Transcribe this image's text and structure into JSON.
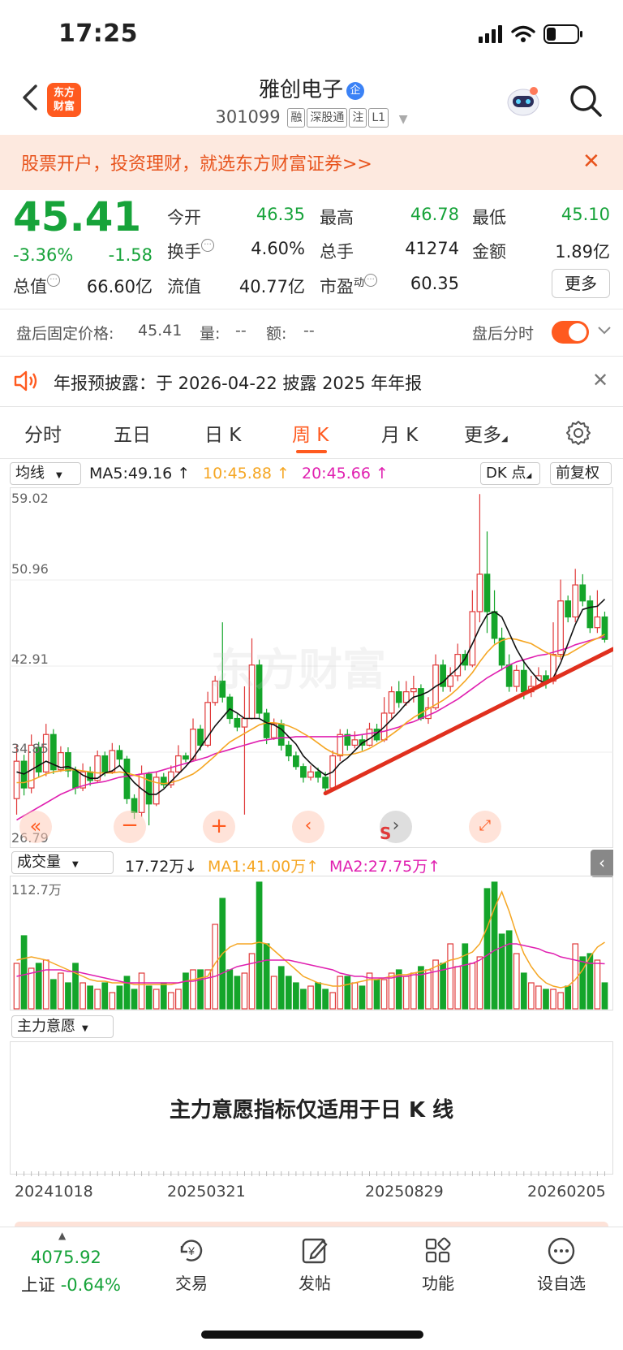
{
  "status": {
    "time": "17:25"
  },
  "header": {
    "logo_line1": "东方",
    "logo_line2": "财富",
    "stock_name": "雅创电子",
    "name_badge": "企",
    "code": "301099",
    "tags": [
      "融",
      "深股通",
      "注",
      "L1"
    ]
  },
  "promo": {
    "text": "股票开户，投资理财，就选东方财富证券>>",
    "close": "✕"
  },
  "quote": {
    "price": "45.41",
    "change_pct": "-3.36%",
    "change_abs": "-1.58",
    "open_label": "今开",
    "open": "46.35",
    "high_label": "最高",
    "high": "46.78",
    "low_label": "最低",
    "low": "45.10",
    "turnover_label": "换手",
    "turnover": "4.60%",
    "volume_label": "总手",
    "volume": "41274",
    "amount_label": "金额",
    "amount": "1.89亿",
    "mktcap_label": "总值",
    "mktcap": "66.60亿",
    "float_label": "流值",
    "float": "40.77亿",
    "pe_label": "市盈",
    "pe_sup": "动",
    "pe": "60.35",
    "more": "更多"
  },
  "after_hours": {
    "label": "盘后固定价格:",
    "price": "45.41",
    "vol_label": "量:",
    "vol": "--",
    "amt_label": "额:",
    "amt": "--",
    "toggle_label": "盘后分时",
    "toggle_on": true
  },
  "notice": {
    "text": "年报预披露：于 2026-04-22 披露 2025 年年报",
    "close": "✕"
  },
  "tabs": [
    {
      "label": "分时"
    },
    {
      "label": "五日"
    },
    {
      "label": "日 K"
    },
    {
      "label": "周 K",
      "active": true
    },
    {
      "label": "月 K"
    },
    {
      "label": "更多"
    }
  ],
  "kline": {
    "indicator": "均线",
    "ma5": "MA5:49.16",
    "ma10": "10:45.88",
    "ma20": "20:45.66",
    "dk": "DK 点",
    "adjust": "前复权",
    "y_ticks": [
      "59.02",
      "50.96",
      "42.91",
      "34.85",
      "26.79"
    ],
    "watermark": "东方财富",
    "colors": {
      "up": "#e03a3a",
      "down": "#14a52a",
      "ma5": "#111111",
      "ma10": "#f5a623",
      "ma20": "#e020b0",
      "trend": "#e0301e"
    }
  },
  "volume": {
    "indicator": "成交量",
    "value": "17.72万",
    "ma1": "MA1:41.00万",
    "ma2": "MA2:27.75万",
    "y_max": "112.7万"
  },
  "zl": {
    "indicator": "主力意愿",
    "message": "主力意愿指标仅适用于日 K 线"
  },
  "dates": [
    "20241018",
    "20250321",
    "20250829",
    "20260205"
  ],
  "bottom": {
    "index_value": "4075.92",
    "index_name": "上证",
    "index_change": "-0.64%",
    "nav": [
      {
        "label": "交易",
        "icon": "yen-cycle-icon"
      },
      {
        "label": "发帖",
        "icon": "edit-icon"
      },
      {
        "label": "功能",
        "icon": "grid-icon"
      },
      {
        "label": "设自选",
        "icon": "more-dots-icon"
      }
    ]
  },
  "chart_data": {
    "type": "candlestick",
    "title": "",
    "y_range": [
      26.79,
      59.02
    ],
    "candles": [
      [
        30.5,
        34.0,
        29.0,
        35.5
      ],
      [
        34.0,
        31.5,
        30.8,
        34.6
      ],
      [
        31.5,
        35.5,
        31.0,
        36.5
      ],
      [
        35.3,
        33.0,
        32.5,
        35.8
      ],
      [
        33.0,
        36.5,
        32.6,
        37.5
      ],
      [
        36.5,
        33.2,
        32.8,
        37.0
      ],
      [
        33.2,
        34.8,
        33.0,
        35.4
      ],
      [
        34.8,
        33.1,
        32.5,
        35.3
      ],
      [
        33.1,
        31.5,
        30.9,
        33.5
      ],
      [
        31.5,
        33.0,
        31.2,
        33.8
      ],
      [
        33.0,
        32.2,
        31.7,
        33.5
      ],
      [
        32.2,
        34.5,
        32.0,
        35.0
      ],
      [
        34.5,
        33.0,
        32.6,
        34.9
      ],
      [
        33.0,
        35.0,
        32.8,
        35.7
      ],
      [
        35.0,
        34.2,
        33.6,
        35.5
      ],
      [
        34.2,
        30.5,
        30.0,
        34.5
      ],
      [
        30.5,
        29.2,
        28.6,
        30.9
      ],
      [
        29.2,
        32.8,
        28.8,
        33.6
      ],
      [
        32.8,
        30.0,
        28.0,
        33.0
      ],
      [
        30.0,
        32.5,
        29.8,
        33.0
      ],
      [
        32.5,
        31.8,
        31.5,
        32.9
      ],
      [
        31.8,
        33.0,
        31.5,
        33.6
      ],
      [
        33.0,
        34.5,
        32.9,
        35.5
      ],
      [
        34.5,
        34.2,
        33.9,
        34.8
      ],
      [
        34.2,
        37.0,
        34.0,
        38.0
      ],
      [
        37.0,
        35.5,
        35.0,
        37.4
      ],
      [
        35.5,
        39.5,
        35.3,
        40.5
      ],
      [
        39.5,
        41.5,
        39.2,
        42.0
      ],
      [
        41.5,
        40.0,
        39.5,
        47.0
      ],
      [
        40.0,
        38.0,
        37.5,
        40.3
      ],
      [
        38.0,
        37.2,
        36.8,
        38.4
      ],
      [
        37.2,
        38.0,
        29.0,
        41.0
      ],
      [
        38.0,
        43.0,
        37.9,
        45.5
      ],
      [
        43.0,
        38.5,
        38.0,
        43.5
      ],
      [
        38.5,
        36.2,
        35.6,
        38.9
      ],
      [
        36.2,
        37.5,
        36.0,
        38.0
      ],
      [
        37.5,
        35.5,
        35.0,
        37.9
      ],
      [
        35.5,
        34.5,
        34.0,
        35.9
      ],
      [
        34.5,
        33.5,
        33.2,
        34.9
      ],
      [
        33.5,
        32.5,
        32.0,
        33.8
      ],
      [
        32.5,
        33.0,
        32.2,
        33.6
      ],
      [
        33.0,
        32.5,
        32.0,
        33.4
      ],
      [
        32.5,
        31.5,
        31.0,
        33.0
      ],
      [
        31.5,
        34.5,
        31.2,
        35.0
      ],
      [
        34.5,
        36.5,
        34.0,
        37.0
      ],
      [
        36.5,
        35.5,
        35.0,
        37.0
      ],
      [
        35.5,
        36.0,
        35.2,
        36.8
      ],
      [
        36.0,
        35.5,
        35.0,
        36.5
      ],
      [
        35.5,
        37.0,
        35.4,
        37.6
      ],
      [
        37.0,
        36.0,
        35.8,
        37.5
      ],
      [
        36.0,
        38.5,
        35.8,
        40.0
      ],
      [
        38.5,
        40.5,
        38.0,
        41.0
      ],
      [
        40.5,
        39.5,
        39.0,
        41.5
      ],
      [
        39.5,
        40.5,
        39.2,
        41.5
      ],
      [
        40.5,
        40.8,
        39.5,
        42.0
      ],
      [
        40.8,
        38.0,
        37.8,
        41.2
      ],
      [
        38.0,
        39.0,
        37.5,
        40.0
      ],
      [
        39.0,
        43.0,
        38.8,
        44.0
      ],
      [
        43.0,
        41.0,
        40.5,
        43.5
      ],
      [
        41.0,
        42.0,
        40.5,
        42.8
      ],
      [
        42.0,
        44.0,
        41.5,
        45.0
      ],
      [
        44.0,
        43.0,
        42.5,
        44.4
      ],
      [
        43.0,
        48.0,
        42.8,
        50.0
      ],
      [
        48.0,
        51.5,
        47.0,
        59.0
      ],
      [
        51.5,
        48.0,
        46.0,
        55.5
      ],
      [
        48.0,
        45.5,
        45.0,
        50.0
      ],
      [
        45.5,
        43.0,
        42.5,
        46.5
      ],
      [
        43.0,
        41.0,
        40.5,
        44.0
      ],
      [
        41.0,
        42.5,
        40.5,
        43.0
      ],
      [
        42.5,
        40.5,
        39.8,
        43.5
      ],
      [
        40.5,
        41.0,
        40.0,
        42.0
      ],
      [
        41.0,
        42.0,
        40.8,
        42.8
      ],
      [
        42.0,
        41.5,
        40.8,
        42.5
      ],
      [
        41.5,
        44.0,
        41.2,
        47.0
      ],
      [
        44.0,
        49.0,
        43.5,
        51.0
      ],
      [
        49.0,
        47.5,
        47.0,
        49.5
      ],
      [
        47.5,
        50.5,
        47.0,
        52.0
      ],
      [
        50.5,
        49.0,
        48.5,
        51.5
      ],
      [
        49.0,
        46.5,
        46.0,
        49.5
      ],
      [
        46.5,
        47.5,
        46.0,
        50.0
      ],
      [
        47.5,
        45.4,
        45.1,
        48.0
      ]
    ],
    "ma5": [
      33,
      32.8,
      33.2,
      33.6,
      34,
      33.7,
      33.4,
      33.5,
      33.2,
      32.7,
      32.4,
      32.4,
      32.9,
      33.1,
      33.6,
      32.8,
      32.0,
      31.4,
      30.9,
      30.9,
      31.4,
      32.1,
      32.8,
      33.5,
      34.3,
      35.3,
      36.3,
      37.3,
      38.1,
      38.9,
      38.5,
      38.0,
      38.0,
      38.0,
      37.6,
      37.4,
      37.0,
      36.3,
      35.6,
      34.5,
      33.8,
      33.2,
      32.7,
      33.0,
      33.8,
      34.3,
      35.0,
      35.7,
      36.1,
      36.6,
      37.2,
      37.9,
      38.6,
      39.4,
      40.0,
      40.2,
      40.5,
      41.0,
      41.4,
      42.1,
      42.7,
      43.6,
      45.0,
      46.5,
      47.7,
      48.0,
      47.5,
      46.0,
      44.5,
      43.3,
      42.4,
      41.6,
      41.3,
      41.8,
      43.2,
      45.0,
      46.8,
      48.2,
      48.4,
      48.5,
      49.16
    ],
    "ma10": [
      32,
      32,
      32.2,
      32.5,
      32.8,
      33,
      33.1,
      33.2,
      33.2,
      33.1,
      33.0,
      32.9,
      32.9,
      32.9,
      33.0,
      32.9,
      32.7,
      32.5,
      32.2,
      32.0,
      31.9,
      32.0,
      32.2,
      32.5,
      32.8,
      33.3,
      33.9,
      34.5,
      35.2,
      35.8,
      36.2,
      36.6,
      37.0,
      37.4,
      37.6,
      37.6,
      37.5,
      37.3,
      37.0,
      36.6,
      36.2,
      35.7,
      35.2,
      34.8,
      34.6,
      34.6,
      34.7,
      34.9,
      35.2,
      35.6,
      36.0,
      36.5,
      37.0,
      37.6,
      38.1,
      38.5,
      38.9,
      39.3,
      39.7,
      40.2,
      40.8,
      41.5,
      42.3,
      43.3,
      44.2,
      44.9,
      45.3,
      45.5,
      45.4,
      45.2,
      45.0,
      44.6,
      44.2,
      43.9,
      43.8,
      44.0,
      44.4,
      44.8,
      45.2,
      45.5,
      45.88
    ],
    "ma20": [
      28.5,
      28.9,
      29.3,
      29.7,
      30.1,
      30.5,
      30.9,
      31.2,
      31.5,
      31.7,
      31.9,
      32.0,
      32.1,
      32.3,
      32.5,
      32.6,
      32.7,
      32.8,
      32.9,
      33.0,
      33.2,
      33.4,
      33.6,
      33.8,
      34.0,
      34.2,
      34.4,
      34.7,
      34.9,
      35.1,
      35.3,
      35.5,
      35.7,
      35.9,
      36.0,
      36.1,
      36.2,
      36.2,
      36.3,
      36.3,
      36.3,
      36.3,
      36.3,
      36.3,
      36.3,
      36.4,
      36.4,
      36.5,
      36.6,
      36.7,
      36.8,
      37.0,
      37.2,
      37.5,
      37.7,
      38.0,
      38.3,
      38.6,
      39.0,
      39.4,
      39.8,
      40.3,
      40.8,
      41.3,
      41.8,
      42.2,
      42.6,
      43.0,
      43.3,
      43.5,
      43.7,
      43.9,
      44.0,
      44.2,
      44.4,
      44.6,
      44.9,
      45.1,
      45.3,
      45.5,
      45.66
    ],
    "volumes": [
      28,
      45,
      25,
      28,
      30,
      18,
      22,
      16,
      28,
      16,
      14,
      12,
      16,
      10,
      14,
      20,
      12,
      22,
      14,
      12,
      16,
      10,
      12,
      22,
      24,
      24,
      24,
      52,
      68,
      24,
      20,
      22,
      34,
      78,
      40,
      20,
      26,
      20,
      16,
      12,
      14,
      16,
      12,
      10,
      20,
      20,
      16,
      14,
      22,
      18,
      18,
      22,
      24,
      20,
      22,
      26,
      24,
      30,
      28,
      40,
      26,
      40,
      28,
      32,
      74,
      78,
      46,
      48,
      34,
      22,
      16,
      14,
      12,
      12,
      10,
      14,
      40,
      32,
      34,
      30,
      16
    ],
    "vol_ma1": [
      30,
      31,
      32,
      31,
      30,
      28,
      26,
      24,
      22,
      20,
      18,
      17,
      17,
      16,
      16,
      16,
      15,
      15,
      15,
      15,
      15,
      15,
      16,
      17,
      18,
      19,
      20,
      28,
      34,
      38,
      40,
      40,
      40,
      41,
      40,
      36,
      32,
      28,
      24,
      20,
      18,
      16,
      15,
      14,
      14,
      15,
      16,
      17,
      18,
      18,
      19,
      20,
      21,
      21,
      22,
      23,
      24,
      26,
      28,
      30,
      31,
      33,
      35,
      40,
      50,
      62,
      72,
      60,
      46,
      34,
      26,
      20,
      16,
      14,
      13,
      14,
      18,
      24,
      32,
      38,
      41
    ],
    "vol_ma2": [
      20,
      21,
      22,
      23,
      24,
      24,
      24,
      23,
      23,
      22,
      21,
      20,
      19,
      18,
      17,
      16,
      16,
      16,
      16,
      16,
      16,
      16,
      16,
      17,
      17,
      18,
      19,
      20,
      22,
      24,
      26,
      27,
      28,
      29,
      30,
      30,
      30,
      30,
      29,
      28,
      27,
      26,
      25,
      24,
      22,
      21,
      20,
      20,
      19,
      19,
      19,
      19,
      20,
      20,
      21,
      21,
      22,
      23,
      24,
      25,
      26,
      27,
      28,
      30,
      33,
      36,
      38,
      40,
      40,
      39,
      38,
      37,
      35,
      34,
      32,
      31,
      30,
      29,
      28,
      28,
      27.75
    ]
  }
}
